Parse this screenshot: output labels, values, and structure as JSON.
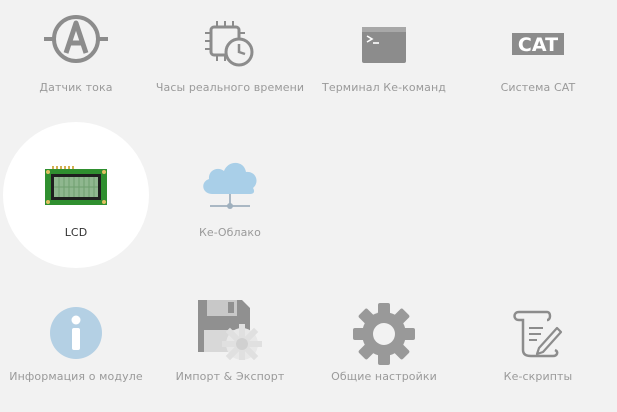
{
  "tiles": [
    {
      "id": "current-sensor",
      "label": "Датчик тока",
      "icon": "ammeter-icon"
    },
    {
      "id": "rtc",
      "label": "Часы реального времени",
      "icon": "chip-clock-icon"
    },
    {
      "id": "terminal",
      "label": "Терминал Ке-команд",
      "icon": "terminal-icon"
    },
    {
      "id": "cat",
      "label": "Система CAT",
      "icon": "cat-logo-icon",
      "icon_text": "CAT"
    },
    {
      "id": "lcd",
      "label": "LCD",
      "icon": "lcd-icon",
      "selected": true
    },
    {
      "id": "cloud",
      "label": "Ке-Облако",
      "icon": "cloud-network-icon"
    },
    {
      "id": "module-info",
      "label": "Информация о модуле",
      "icon": "info-icon"
    },
    {
      "id": "import-export",
      "label": "Импорт & Экспорт",
      "icon": "floppy-gear-icon"
    },
    {
      "id": "settings",
      "label": "Общие настройки",
      "icon": "gear-icon"
    },
    {
      "id": "scripts",
      "label": "Ке-скрипты",
      "icon": "scroll-pen-icon"
    }
  ],
  "colors": {
    "background": "#f2f2f2",
    "selected_bg": "#ffffff",
    "label": "#9a9a9a",
    "label_selected": "#333333",
    "icon_gray": "#8c8c8c",
    "lcd_green": "#2f8f2f",
    "cloud_blue": "#a9cfe8",
    "info_blue": "#b4d0e4"
  }
}
